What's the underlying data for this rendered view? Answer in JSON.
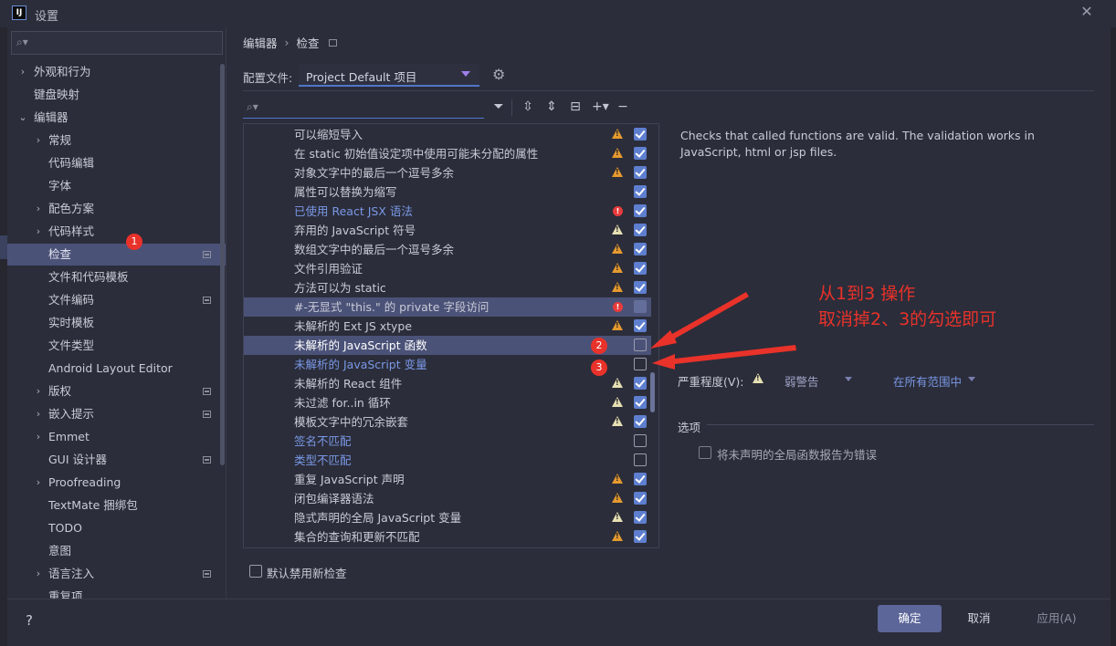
{
  "window": {
    "title": "设置",
    "logo_text": "IJ"
  },
  "sidebar": {
    "search_placeholder": "",
    "items": [
      {
        "label": "外观和行为",
        "chevron": "›",
        "top": 0
      },
      {
        "label": "键盘映射"
      },
      {
        "label": "编辑器",
        "chevron": "⌄"
      },
      {
        "label": "常规",
        "chevron": "›"
      },
      {
        "label": "代码编辑"
      },
      {
        "label": "字体"
      },
      {
        "label": "配色方案",
        "chevron": "›"
      },
      {
        "label": "代码样式",
        "chevron": "›"
      },
      {
        "label": "检查",
        "selected": true,
        "page_icon": true
      },
      {
        "label": "文件和代码模板"
      },
      {
        "label": "文件编码",
        "page_icon": true
      },
      {
        "label": "实时模板"
      },
      {
        "label": "文件类型"
      },
      {
        "label": "Android Layout Editor"
      },
      {
        "label": "版权",
        "chevron": "›",
        "page_icon": true
      },
      {
        "label": "嵌入提示",
        "chevron": "›",
        "page_icon": true
      },
      {
        "label": "Emmet",
        "chevron": "›"
      },
      {
        "label": "GUI 设计器",
        "page_icon": true
      },
      {
        "label": "Proofreading",
        "chevron": "›"
      },
      {
        "label": "TextMate 捆绑包"
      },
      {
        "label": "TODO"
      },
      {
        "label": "意图"
      },
      {
        "label": "语言注入",
        "chevron": "›",
        "page_icon": true
      },
      {
        "label": "重复项"
      }
    ]
  },
  "breadcrumb": {
    "parent": "编辑器",
    "separator": "›",
    "current": "检查"
  },
  "profile": {
    "label": "配置文件:",
    "value": "Project Default  项目"
  },
  "inspections": [
    {
      "label": "可以缩短导入",
      "sev": "warn",
      "checked": "on"
    },
    {
      "label": "在 static 初始值设定项中使用可能未分配的属性",
      "sev": "warn",
      "checked": "on"
    },
    {
      "label": "对象文字中的最后一个逗号多余",
      "sev": "warn",
      "checked": "on"
    },
    {
      "label": "属性可以替换为缩写",
      "sev": "",
      "checked": "on"
    },
    {
      "label": "已使用 React JSX 语法",
      "sev": "err",
      "checked": "on",
      "link": true
    },
    {
      "label": "弃用的 JavaScript 符号",
      "sev": "weak",
      "checked": "on"
    },
    {
      "label": "数组文字中的最后一个逗号多余",
      "sev": "warn",
      "checked": "on"
    },
    {
      "label": "文件引用验证",
      "sev": "warn",
      "checked": "on"
    },
    {
      "label": "方法可以为 static",
      "sev": "warn",
      "checked": "on"
    },
    {
      "label": "#-无显式 \"this.\" 的 private 字段访问",
      "sev": "err",
      "checked": "dim",
      "row": "soft"
    },
    {
      "label": "未解析的 Ext JS xtype",
      "sev": "warn",
      "checked": "on"
    },
    {
      "label": "未解析的 JavaScript 函数",
      "sev": "",
      "checked": "off",
      "row": "strong"
    },
    {
      "label": "未解析的 JavaScript 变量",
      "sev": "",
      "checked": "off",
      "link": true
    },
    {
      "label": "未解析的 React 组件",
      "sev": "weak",
      "checked": "on"
    },
    {
      "label": "未过滤 for..in 循环",
      "sev": "weak",
      "checked": "on"
    },
    {
      "label": "模板文字中的冗余嵌套",
      "sev": "weak",
      "checked": "on"
    },
    {
      "label": "签名不匹配",
      "sev": "",
      "checked": "off",
      "link": true
    },
    {
      "label": "类型不匹配",
      "sev": "",
      "checked": "off",
      "link": true
    },
    {
      "label": "重复 JavaScript 声明",
      "sev": "warn",
      "checked": "on"
    },
    {
      "label": "闭包编译器语法",
      "sev": "warn",
      "checked": "on"
    },
    {
      "label": "隐式声明的全局 JavaScript 变量",
      "sev": "weak",
      "checked": "on"
    },
    {
      "label": "集合的查询和更新不匹配",
      "sev": "warn",
      "checked": "on"
    }
  ],
  "description": "Checks that called functions are valid. The validation works in JavaScript, html or jsp files.",
  "severity": {
    "label": "严重程度(V):",
    "value": "弱警告",
    "scope": "在所有范围中"
  },
  "options": {
    "label": "选项",
    "checkbox_label": "将未声明的全局函数报告为错误"
  },
  "disable_new": "默认禁用新检查",
  "annotation": {
    "line1": "从1到3 操作",
    "line2": "取消掉2、3的勾选即可"
  },
  "badges": {
    "b1": "1",
    "b2": "2",
    "b3": "3"
  },
  "footer": {
    "help": "?",
    "ok": "确定",
    "cancel": "取消",
    "apply": "应用(A)"
  },
  "colors": {
    "accent": "#4f76c9",
    "selection": "#4b5278",
    "annotation": "#e8322a",
    "warning": "#e59a2f"
  }
}
